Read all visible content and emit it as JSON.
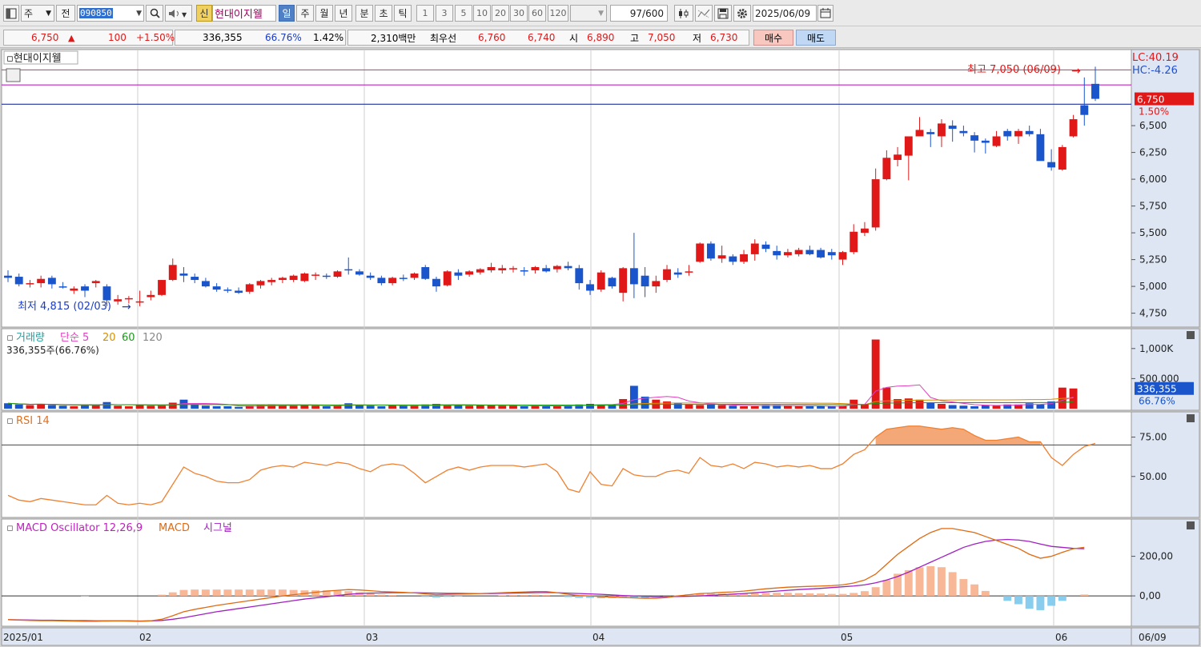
{
  "toolbar": {
    "market": "주",
    "view": "전",
    "code": "090850",
    "name_badge": "신",
    "stock_name": "현대이지웰",
    "periods": [
      "일",
      "주",
      "월",
      "년",
      "분",
      "초",
      "틱"
    ],
    "active_period": "일",
    "intervals": [
      "1",
      "3",
      "5",
      "10",
      "20",
      "30",
      "60",
      "120"
    ],
    "count": "97",
    "count_total": "/600",
    "date": "2025/06/09"
  },
  "info": {
    "price": "6,750",
    "change_arrow": "▲",
    "change": "100",
    "change_pct": "+1.50%",
    "volume": "336,355",
    "volume_ratio": "66.76%",
    "turnover": "1.42%",
    "amount": "2,310백만",
    "best_label": "최우선",
    "best_ask": "6,760",
    "best_bid": "6,740",
    "open_label": "시",
    "open": "6,890",
    "high_label": "고",
    "high": "7,050",
    "low_label": "저",
    "low": "6,730",
    "buy_label": "매수",
    "sell_label": "매도"
  },
  "chart_data": [
    {
      "type": "candlestick",
      "title": "현대이지웰",
      "ylim": [
        4650,
        7150
      ],
      "y_ticks": [
        "4,750",
        "5,000",
        "5,250",
        "5,500",
        "5,750",
        "6,000",
        "6,250",
        "6,500"
      ],
      "current_price_label": "6,750",
      "current_pct_label": "1.50%",
      "lc_label": "LC:40.19",
      "hc_label": "HC:-4.26",
      "high_annotation": "최고 7,050 (06/09)",
      "low_annotation": "최저 4,815 (02/03)",
      "reference_lines": [
        7020,
        6880,
        6700
      ],
      "x_labels": [
        "2025/01",
        "02",
        "03",
        "04",
        "05",
        "06",
        "06/09"
      ],
      "ohlc": [
        [
          5100,
          5150,
          5040,
          5080
        ],
        [
          5090,
          5120,
          5000,
          5020
        ],
        [
          5020,
          5060,
          4990,
          5030
        ],
        [
          5030,
          5100,
          4990,
          5070
        ],
        [
          5080,
          5100,
          4980,
          5020
        ],
        [
          5000,
          5040,
          4980,
          4990
        ],
        [
          4960,
          5000,
          4930,
          4980
        ],
        [
          5000,
          5020,
          4900,
          4960
        ],
        [
          5030,
          5060,
          4990,
          5050
        ],
        [
          5000,
          5020,
          4815,
          4870
        ],
        [
          4860,
          4920,
          4830,
          4880
        ],
        [
          4880,
          4910,
          4840,
          4890
        ],
        [
          4860,
          4960,
          4815,
          4860
        ],
        [
          4900,
          4960,
          4870,
          4920
        ],
        [
          4920,
          5060,
          4910,
          5060
        ],
        [
          5060,
          5260,
          5050,
          5200
        ],
        [
          5120,
          5180,
          5040,
          5100
        ],
        [
          5090,
          5120,
          5030,
          5060
        ],
        [
          5050,
          5080,
          4990,
          5000
        ],
        [
          5000,
          5030,
          4950,
          4970
        ],
        [
          4970,
          4990,
          4940,
          4960
        ],
        [
          4960,
          4990,
          4930,
          4940
        ],
        [
          4950,
          5030,
          4930,
          5020
        ],
        [
          5010,
          5060,
          4980,
          5050
        ],
        [
          5040,
          5080,
          5010,
          5060
        ],
        [
          5060,
          5090,
          5030,
          5080
        ],
        [
          5060,
          5110,
          5040,
          5100
        ],
        [
          5050,
          5130,
          5040,
          5120
        ],
        [
          5100,
          5130,
          5060,
          5110
        ],
        [
          5100,
          5120,
          5070,
          5090
        ],
        [
          5090,
          5150,
          5080,
          5140
        ],
        [
          5160,
          5270,
          5110,
          5150
        ],
        [
          5140,
          5160,
          5100,
          5110
        ],
        [
          5100,
          5130,
          5060,
          5080
        ],
        [
          5080,
          5100,
          5010,
          5030
        ],
        [
          5030,
          5090,
          5010,
          5080
        ],
        [
          5080,
          5110,
          5050,
          5070
        ],
        [
          5080,
          5130,
          5060,
          5120
        ],
        [
          5180,
          5200,
          5060,
          5070
        ],
        [
          5070,
          5090,
          4950,
          5000
        ],
        [
          5010,
          5150,
          5000,
          5140
        ],
        [
          5130,
          5160,
          5060,
          5100
        ],
        [
          5110,
          5150,
          5090,
          5140
        ],
        [
          5130,
          5170,
          5110,
          5160
        ],
        [
          5150,
          5220,
          5130,
          5180
        ],
        [
          5150,
          5200,
          5120,
          5170
        ],
        [
          5160,
          5190,
          5130,
          5170
        ],
        [
          5150,
          5180,
          5100,
          5140
        ],
        [
          5150,
          5190,
          5120,
          5180
        ],
        [
          5170,
          5200,
          5130,
          5140
        ],
        [
          5160,
          5200,
          5130,
          5190
        ],
        [
          5190,
          5230,
          5150,
          5170
        ],
        [
          5170,
          5200,
          4970,
          5030
        ],
        [
          5020,
          5060,
          4920,
          4960
        ],
        [
          4970,
          5150,
          4950,
          5130
        ],
        [
          5080,
          5090,
          4980,
          5000
        ],
        [
          4940,
          5180,
          4860,
          5170
        ],
        [
          5170,
          5500,
          4890,
          5020
        ],
        [
          5100,
          5180,
          4900,
          5000
        ],
        [
          5000,
          5100,
          4940,
          5050
        ],
        [
          5060,
          5200,
          5040,
          5160
        ],
        [
          5130,
          5170,
          5080,
          5110
        ],
        [
          5130,
          5200,
          5100,
          5140
        ],
        [
          5230,
          5410,
          5220,
          5400
        ],
        [
          5400,
          5420,
          5240,
          5260
        ],
        [
          5260,
          5380,
          5220,
          5290
        ],
        [
          5280,
          5300,
          5200,
          5230
        ],
        [
          5230,
          5340,
          5210,
          5300
        ],
        [
          5300,
          5440,
          5240,
          5400
        ],
        [
          5390,
          5420,
          5320,
          5350
        ],
        [
          5330,
          5380,
          5250,
          5290
        ],
        [
          5290,
          5350,
          5270,
          5320
        ],
        [
          5300,
          5360,
          5280,
          5340
        ],
        [
          5340,
          5380,
          5290,
          5300
        ],
        [
          5340,
          5360,
          5260,
          5270
        ],
        [
          5320,
          5350,
          5250,
          5290
        ],
        [
          5250,
          5330,
          5200,
          5320
        ],
        [
          5320,
          5580,
          5300,
          5510
        ],
        [
          5500,
          5600,
          5470,
          5540
        ],
        [
          5550,
          6100,
          5520,
          6000
        ],
        [
          6000,
          6270,
          5990,
          6200
        ],
        [
          6180,
          6300,
          6120,
          6230
        ],
        [
          6220,
          6360,
          5990,
          6400
        ],
        [
          6400,
          6580,
          6420,
          6460
        ],
        [
          6440,
          6470,
          6300,
          6420
        ],
        [
          6400,
          6560,
          6300,
          6520
        ],
        [
          6500,
          6550,
          6350,
          6470
        ],
        [
          6450,
          6500,
          6400,
          6430
        ],
        [
          6410,
          6440,
          6250,
          6360
        ],
        [
          6360,
          6380,
          6240,
          6340
        ],
        [
          6310,
          6450,
          6300,
          6400
        ],
        [
          6450,
          6470,
          6360,
          6400
        ],
        [
          6400,
          6470,
          6330,
          6450
        ],
        [
          6450,
          6500,
          6400,
          6420
        ],
        [
          6420,
          6470,
          6290,
          6170
        ],
        [
          6160,
          6280,
          6080,
          6110
        ],
        [
          6090,
          6320,
          6080,
          6300
        ],
        [
          6400,
          6600,
          6390,
          6560
        ],
        [
          6690,
          6950,
          6500,
          6600
        ],
        [
          6890,
          7050,
          6730,
          6750
        ]
      ],
      "series_colors": {
        "up": "#e01818",
        "down": "#1a55cc"
      }
    },
    {
      "type": "bar",
      "title": "거래량",
      "legend": [
        "단순",
        "5",
        "20",
        "60",
        "120"
      ],
      "legend_colors": [
        "#e040c0",
        "#e040c0",
        "#d89000",
        "#1a9a1a",
        "#888888"
      ],
      "volume_label": "336,355주(66.76%)",
      "y_ticks": [
        "1,000K",
        "500,000"
      ],
      "current_label": "336,355",
      "current_pct_label": "66.76%",
      "values": [
        90,
        70,
        60,
        80,
        60,
        50,
        40,
        70,
        60,
        110,
        50,
        40,
        60,
        50,
        60,
        100,
        150,
        70,
        50,
        40,
        40,
        30,
        50,
        60,
        70,
        50,
        50,
        60,
        50,
        40,
        50,
        90,
        60,
        50,
        40,
        60,
        50,
        60,
        70,
        80,
        60,
        60,
        50,
        60,
        60,
        50,
        50,
        40,
        50,
        40,
        50,
        60,
        70,
        80,
        70,
        60,
        160,
        380,
        200,
        150,
        120,
        90,
        70,
        60,
        70,
        60,
        50,
        40,
        40,
        60,
        60,
        50,
        40,
        40,
        40,
        40,
        50,
        150,
        70,
        1150,
        350,
        160,
        170,
        150,
        100,
        80,
        60,
        50,
        40,
        60,
        60,
        70,
        70,
        90,
        70,
        120,
        350,
        336
      ]
    },
    {
      "type": "line",
      "title": "RSI 14",
      "y_ticks": [
        "75.00",
        "50.00"
      ],
      "threshold": 70,
      "ylim": [
        25,
        90
      ],
      "values": [
        38,
        35,
        34,
        36,
        35,
        34,
        33,
        32,
        32,
        38,
        33,
        32,
        33,
        32,
        34,
        45,
        56,
        52,
        50,
        47,
        46,
        46,
        48,
        54,
        56,
        57,
        56,
        59,
        58,
        57,
        59,
        58,
        55,
        53,
        57,
        58,
        57,
        52,
        46,
        50,
        54,
        56,
        54,
        56,
        57,
        57,
        57,
        56,
        57,
        58,
        53,
        42,
        40,
        53,
        45,
        44,
        55,
        51,
        50,
        50,
        53,
        54,
        52,
        62,
        57,
        56,
        58,
        55,
        59,
        58,
        56,
        57,
        56,
        57,
        55,
        55,
        58,
        64,
        67,
        75,
        80,
        81,
        82,
        82,
        81,
        80,
        81,
        80,
        76,
        73,
        73,
        74,
        75,
        72,
        72,
        62,
        57,
        64,
        69,
        71
      ]
    },
    {
      "type": "line",
      "title": "MACD Oscillator 12,26,9",
      "legend": [
        "MACD",
        "시그널"
      ],
      "legend_colors": [
        "#e06a10",
        "#a020c0"
      ],
      "y_ticks": [
        "200,00",
        "0,00"
      ],
      "ylim": [
        -145,
        380
      ],
      "macd": [
        -120,
        -122,
        -124,
        -125,
        -125,
        -126,
        -127,
        -128,
        -128,
        -127,
        -126,
        -127,
        -128,
        -126,
        -118,
        -100,
        -80,
        -68,
        -58,
        -48,
        -40,
        -32,
        -24,
        -16,
        -8,
        0,
        6,
        12,
        18,
        24,
        28,
        32,
        30,
        26,
        22,
        20,
        18,
        15,
        10,
        6,
        8,
        9,
        10,
        12,
        14,
        16,
        18,
        20,
        22,
        22,
        16,
        8,
        2,
        0,
        -4,
        -6,
        -8,
        -10,
        -12,
        -12,
        -8,
        0,
        6,
        12,
        14,
        18,
        20,
        24,
        30,
        36,
        40,
        44,
        46,
        48,
        50,
        52,
        56,
        65,
        80,
        110,
        160,
        210,
        250,
        290,
        320,
        340,
        340,
        330,
        320,
        300,
        280,
        260,
        240,
        210,
        190,
        200,
        220,
        238,
        245
      ],
      "signal": [
        -120,
        -121,
        -122,
        -123,
        -123,
        -124,
        -125,
        -125,
        -126,
        -126,
        -126,
        -126,
        -127,
        -126,
        -124,
        -118,
        -110,
        -100,
        -90,
        -80,
        -72,
        -64,
        -56,
        -48,
        -40,
        -32,
        -24,
        -16,
        -10,
        -4,
        2,
        8,
        12,
        14,
        15,
        16,
        16,
        16,
        15,
        14,
        13,
        13,
        12,
        12,
        12,
        13,
        14,
        15,
        16,
        17,
        16,
        14,
        12,
        10,
        8,
        5,
        2,
        0,
        -2,
        -4,
        -4,
        -3,
        -2,
        0,
        3,
        6,
        9,
        12,
        16,
        20,
        24,
        28,
        32,
        35,
        38,
        42,
        46,
        50,
        56,
        66,
        80,
        98,
        120,
        145,
        170,
        195,
        220,
        245,
        262,
        275,
        282,
        285,
        282,
        275,
        262,
        250,
        245,
        240,
        238
      ]
    }
  ]
}
